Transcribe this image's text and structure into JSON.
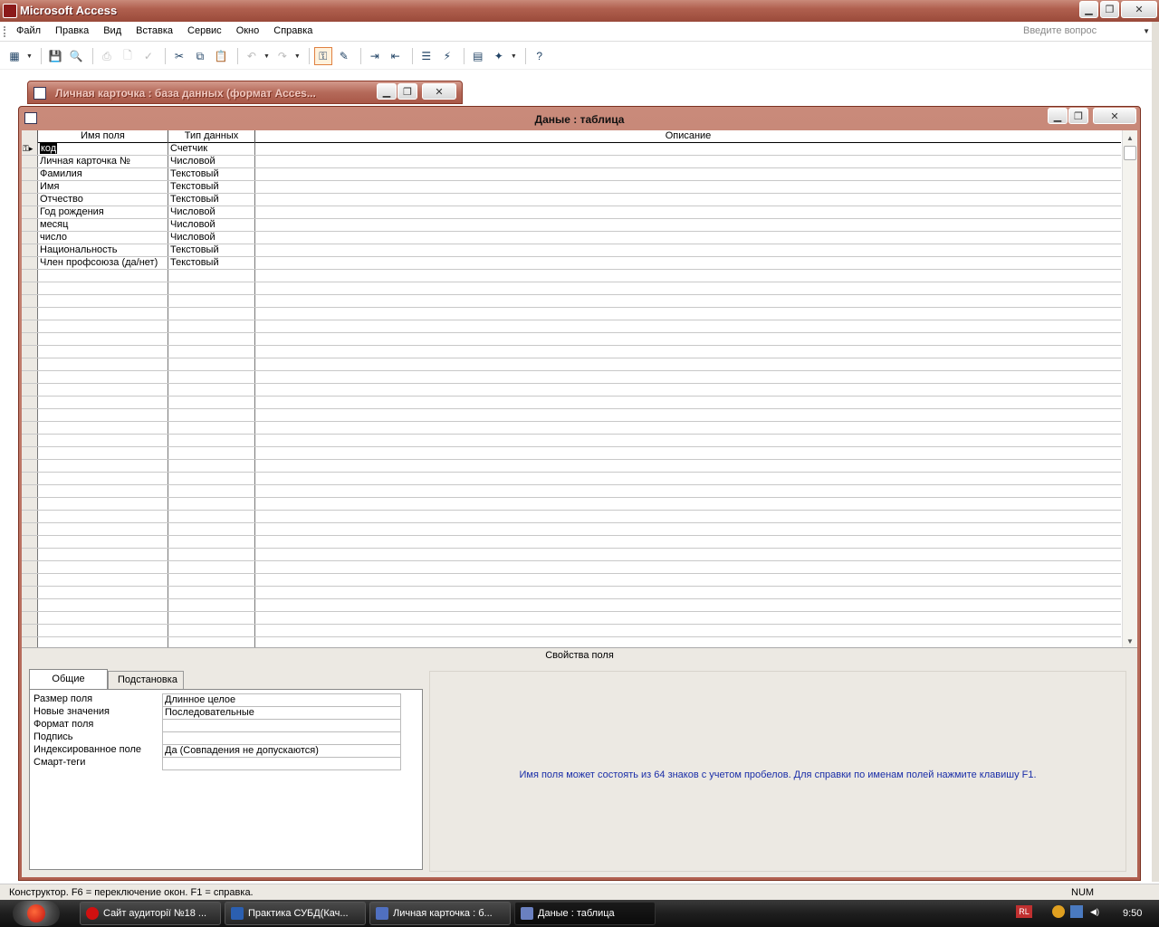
{
  "app": {
    "title": "Microsoft Access",
    "icon": "access-key-icon"
  },
  "menu": {
    "items": [
      "Файл",
      "Правка",
      "Вид",
      "Вставка",
      "Сервис",
      "Окно",
      "Справка"
    ],
    "ask_placeholder": "Введите вопрос"
  },
  "toolbar": {
    "buttons": [
      "view-icon",
      "save-icon",
      "search-icon",
      "print-icon",
      "print-preview-icon",
      "spelling-icon",
      "cut-icon",
      "copy-icon",
      "paste-icon",
      "undo-icon",
      "redo-icon",
      "primary-key-icon",
      "builder-icon",
      "insert-rows-icon",
      "delete-rows-icon",
      "properties-icon",
      "indexes-icon",
      "database-window-icon",
      "new-object-icon",
      "help-icon"
    ]
  },
  "minimized_window": {
    "title": "Личная карточка : база данных (формат Acces..."
  },
  "table_window": {
    "title": "Даные : таблица",
    "columns": {
      "name": "Имя поля",
      "type": "Тип данных",
      "description": "Описание"
    },
    "rows": [
      {
        "name": "код",
        "type": "Счетчик",
        "description": ""
      },
      {
        "name": "Личная карточка №",
        "type": "Числовой",
        "description": ""
      },
      {
        "name": "Фамилия",
        "type": "Текстовый",
        "description": ""
      },
      {
        "name": "Имя",
        "type": "Текстовый",
        "description": ""
      },
      {
        "name": "Отчество",
        "type": "Текстовый",
        "description": ""
      },
      {
        "name": "Год рождения",
        "type": "Числовой",
        "description": ""
      },
      {
        "name": "месяц",
        "type": "Числовой",
        "description": ""
      },
      {
        "name": "число",
        "type": "Числовой",
        "description": ""
      },
      {
        "name": "Национальность",
        "type": "Текстовый",
        "description": ""
      },
      {
        "name": "Член профсоюза (да/нет)",
        "type": "Текстовый",
        "description": ""
      }
    ],
    "properties_title": "Свойства поля",
    "tabs": [
      "Общие",
      "Подстановка"
    ],
    "properties": [
      {
        "label": "Размер поля",
        "value": "Длинное целое"
      },
      {
        "label": "Новые значения",
        "value": "Последовательные"
      },
      {
        "label": "Формат поля",
        "value": ""
      },
      {
        "label": "Подпись",
        "value": ""
      },
      {
        "label": "Индексированное поле",
        "value": "Да (Совпадения не допускаются)"
      },
      {
        "label": "Смарт-теги",
        "value": ""
      }
    ],
    "hint": "Имя поля может состоять из 64 знаков с учетом пробелов.  Для справки по именам полей нажмите клавишу F1."
  },
  "statusbar": {
    "text": "Конструктор.  F6 = переключение окон.  F1 = справка.",
    "num": "NUM"
  },
  "taskbar": {
    "buttons": [
      {
        "label": "Сайт аудиторії №18 ...",
        "icon": "opera-icon",
        "color": "#d01010"
      },
      {
        "label": "Практика СУБД(Кач...",
        "icon": "word-icon",
        "color": "#2b5fb0"
      },
      {
        "label": "Личная карточка : б...",
        "icon": "access-db-icon",
        "color": "#5070c0"
      },
      {
        "label": "Даные : таблица",
        "icon": "table-icon",
        "color": "#6a80c0"
      }
    ],
    "tray_lang": "RL",
    "clock": "9:50"
  }
}
